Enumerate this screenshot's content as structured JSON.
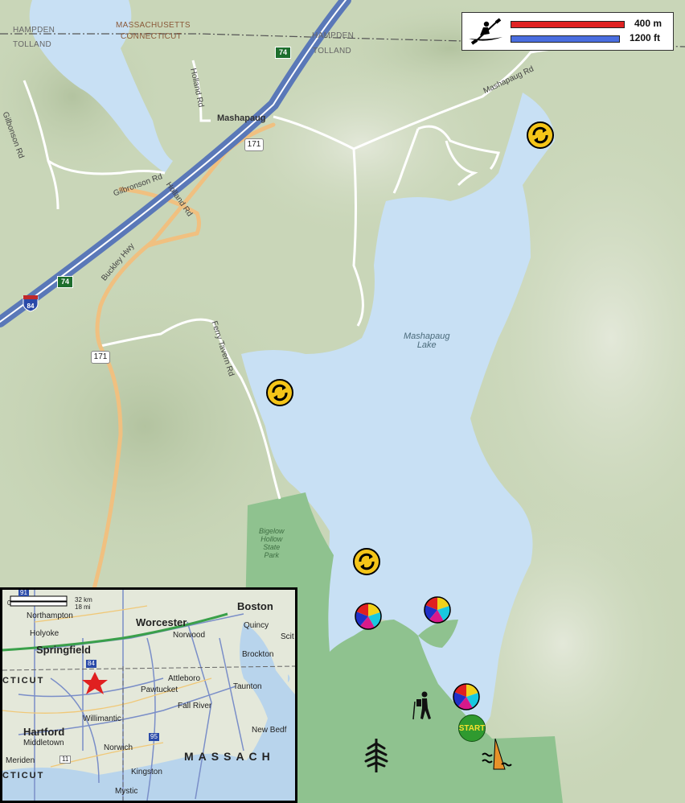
{
  "labels": {
    "state_ma": "MASSACHUSETTS",
    "state_ct": "CONNECTICUT",
    "county_hampden_w": "HAMPDEN",
    "county_tolland_w": "TOLLAND",
    "county_hampden_e": "HAMPDEN",
    "county_tolland_e": "TOLLAND",
    "gilbonson_rd": "Gilbonson Rd",
    "holland_rd_n": "Holland Rd",
    "mashapaug_rd": "Mashapaug Rd",
    "town": "Mashapaug",
    "gilbronson_rd": "Gilbronson Rd",
    "holland_rd_s": "Holland Rd",
    "buckley_hwy": "Buckley Hwy",
    "ferry_tavern_rd": "Ferry Tavern Rd",
    "lake": "Mashapaug\nLake",
    "park": "Bigelow\nHollow\nState\nPark"
  },
  "shields": {
    "rt171_a": "171",
    "rt171_b": "171",
    "exit74_a": "74",
    "exit74_b": "74",
    "i84": "84"
  },
  "scale": {
    "metric": "400 m",
    "imperial": "1200 ft"
  },
  "markers": {
    "start": "START",
    "icons": [
      "kayak-icon",
      "turnaround-icon",
      "beach-ball-icon",
      "hiker-icon",
      "tree-icon",
      "boat-launch-icon"
    ]
  },
  "inset": {
    "scale_zero": "0",
    "scale_km": "32 km",
    "scale_mi": "18 mi",
    "route_91": "91",
    "route_84": "84",
    "route_95": "95",
    "route_11": "11",
    "boston": "Boston",
    "quincy": "Quincy",
    "scit": "Scit",
    "northampton": "Northampton",
    "worcester": "Worcester",
    "holyoke": "Holyoke",
    "norwood": "Norwood",
    "springfield": "Springfield",
    "brockton": "Brockton",
    "cticut_top": "CTICUT",
    "attleboro": "Attleboro",
    "pawtucket": "Pawtucket",
    "taunton": "Taunton",
    "willimantic": "Willimantic",
    "fall_river": "Fall River",
    "hartford": "Hartford",
    "new_bedf": "New Bedf",
    "middletown": "Middletown",
    "norwich": "Norwich",
    "massach": "MASSACH",
    "meriden": "Meriden",
    "kingston": "Kingston",
    "cticut_bottom": "CTICUT",
    "mystic": "Mystic"
  },
  "colors": {
    "water": "#c8e0f4",
    "park": "#8fc28f",
    "terrain": "#c9d6b8",
    "highway": "#5a78b8",
    "secondary_road": "#f0c080",
    "red_scale": "#e02222",
    "blue_scale": "#4a6ee0"
  }
}
